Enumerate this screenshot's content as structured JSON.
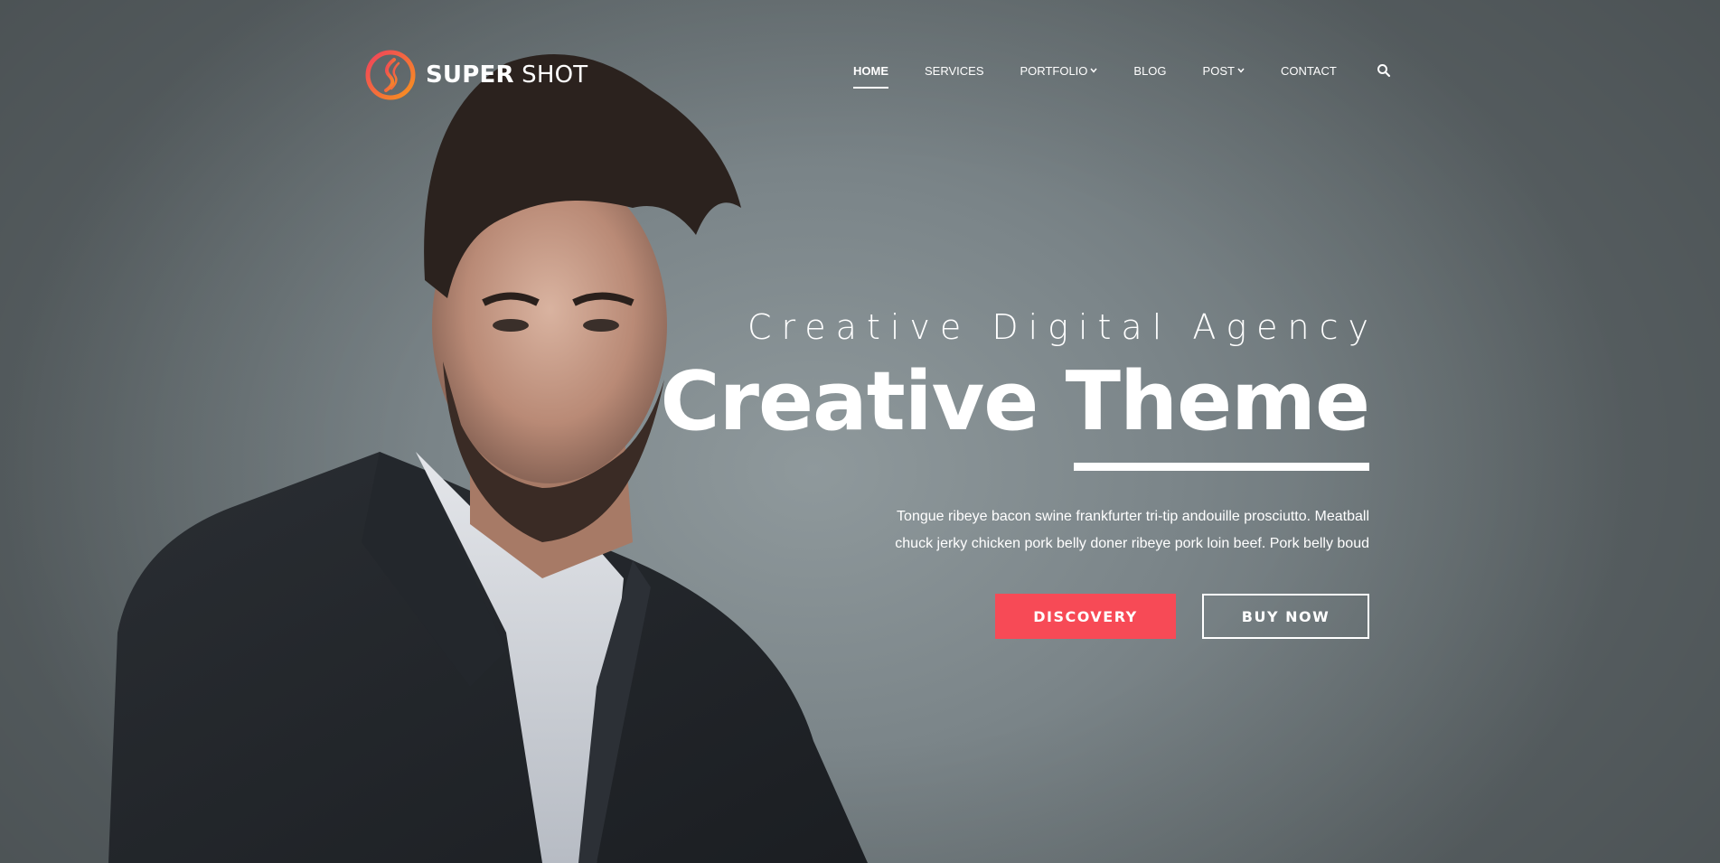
{
  "brand": {
    "name_bold": "SUPER",
    "name_light": "SHOT",
    "logo_icon": "swirl-logo-icon",
    "colors": {
      "logo_orange": "#f7931e",
      "logo_red": "#f0425c"
    }
  },
  "nav": {
    "items": [
      {
        "label": "HOME",
        "active": true,
        "dropdown": false
      },
      {
        "label": "SERVICES",
        "active": false,
        "dropdown": false
      },
      {
        "label": "PORTFOLIO",
        "active": false,
        "dropdown": true
      },
      {
        "label": "BLOG",
        "active": false,
        "dropdown": false
      },
      {
        "label": "POST",
        "active": false,
        "dropdown": true
      },
      {
        "label": "CONTACT",
        "active": false,
        "dropdown": false
      }
    ],
    "search_icon": "search-icon",
    "caret_glyph": "⌄"
  },
  "hero": {
    "subtitle": "Creative Digital Agency",
    "title": "Creative Theme",
    "description_line1": "Tongue ribeye bacon swine frankfurter tri-tip andouille prosciutto. Meatball",
    "description_line2": "chuck jerky chicken pork belly doner ribeye pork loin beef. Pork belly boud",
    "primary_button": "DISCOVERY",
    "secondary_button": "BUY NOW",
    "colors": {
      "accent": "#f74a56",
      "text": "#ffffff",
      "background": "#7b8589"
    }
  }
}
